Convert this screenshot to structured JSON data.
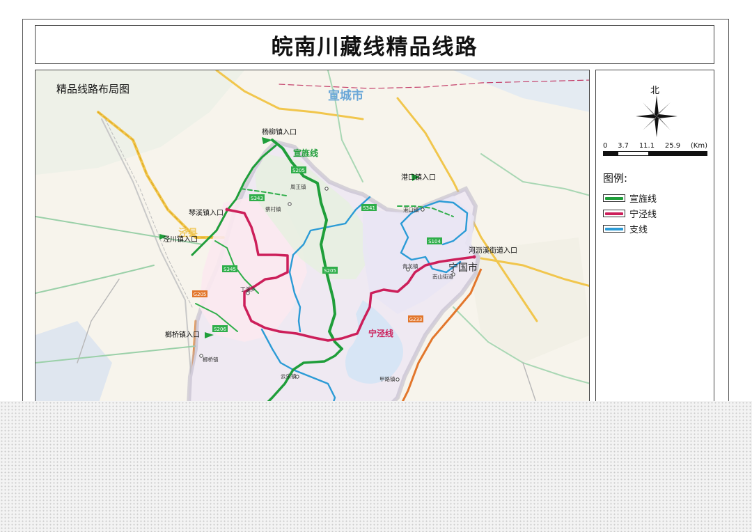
{
  "title": "皖南川藏线精品线路",
  "map": {
    "subtitle": "精品线路布局图",
    "city_labels": {
      "xuancheng": "宣城市",
      "ningguo": "宁国市",
      "jingxian": "泾县"
    },
    "entrance_labels": {
      "yangliu": "杨柳镇入口",
      "qinxi": "琴溪镇入口",
      "jingchuan": "泾川镇入口",
      "gangkou": "港口镇入口",
      "heli": "河沥溪街道入口",
      "lanqiao": "榔桥镇入口"
    },
    "route_labels": {
      "xuanjing": "宣旌线",
      "ningjing": "宁泾线"
    },
    "town_labels": {
      "zhouwang": "周王镇",
      "caicun": "蔡村镇",
      "dingxi": "丁溪乡",
      "qinglong": "青龙镇",
      "nanshan": "南山街道",
      "gangkouzhen": "港口镇",
      "lanqiaozhen": "榔桥镇",
      "yunle": "云乐镇",
      "jiaxi": "甲路镇"
    },
    "road_labels": {
      "s205a": "S205",
      "s205b": "S205",
      "s343": "S343",
      "s341": "S341",
      "s104": "S104",
      "s345": "S345",
      "s206": "S206",
      "g205": "G205",
      "g233": "G233"
    }
  },
  "legend": {
    "north": "北",
    "scale_labels": [
      "0",
      "3.7",
      "11.1",
      "25.9",
      "(Km)"
    ],
    "title": "图例:",
    "items": [
      {
        "label": "宣旌线",
        "color": "#1f9e3a"
      },
      {
        "label": "宁泾线",
        "color": "#cc1f5a"
      },
      {
        "label": "支线",
        "color": "#2b9bd6"
      }
    ]
  }
}
